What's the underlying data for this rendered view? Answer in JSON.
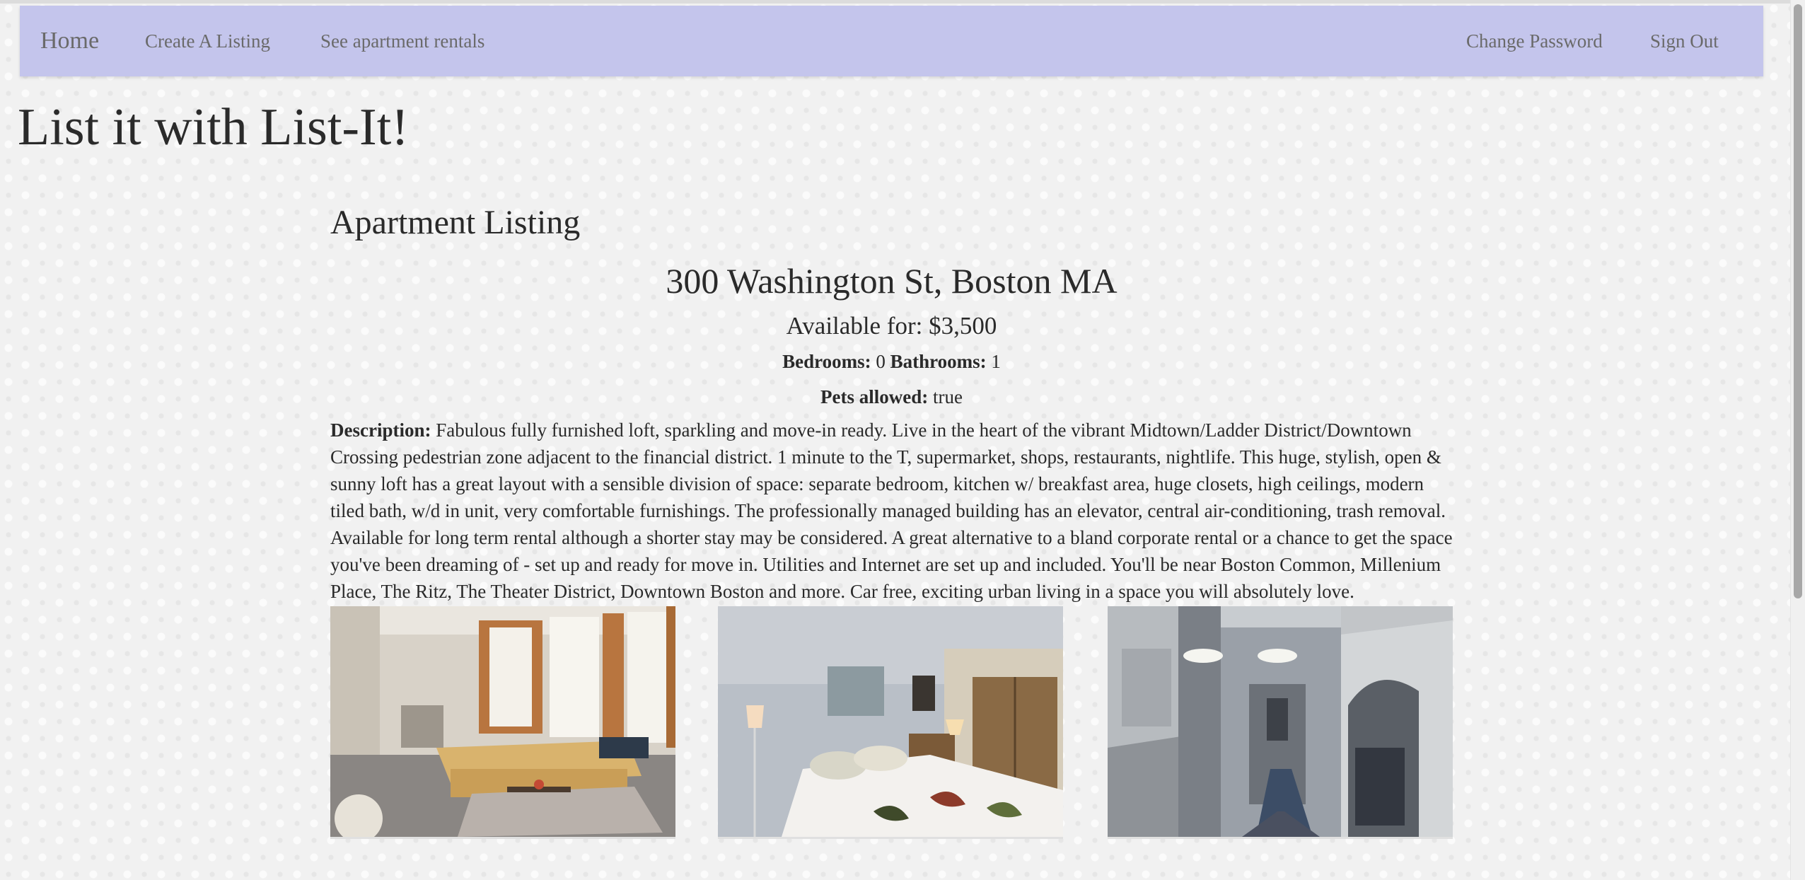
{
  "nav": {
    "home": "Home",
    "create_listing": "Create A Listing",
    "see_rentals": "See apartment rentals",
    "change_password": "Change Password",
    "sign_out": "Sign Out"
  },
  "site_title": "List it with List-It!",
  "section_title": "Apartment Listing",
  "listing": {
    "address": "300 Washington St, Boston MA",
    "price_label": "Available for:",
    "price": "$3,500",
    "bedrooms_label": "Bedrooms:",
    "bedrooms": "0",
    "bathrooms_label": "Bathrooms:",
    "bathrooms": "1",
    "pets_label": "Pets allowed:",
    "pets": "true",
    "description_label": "Description:",
    "description": "Fabulous fully furnished loft, sparkling and move-in ready. Live in the heart of the vibrant Midtown/Ladder District/Downtown Crossing pedestrian zone adjacent to the financial district. 1 minute to the T, supermarket, shops, restaurants, nightlife. This huge, stylish, open & sunny loft has a great layout with a sensible division of space: separate bedroom, kitchen w/ breakfast area, huge closets, high ceilings, modern tiled bath, w/d in unit, very comfortable furnishings. The professionally managed building has an elevator, central air-conditioning, trash removal. Available for long term rental although a shorter stay may be considered. A great alternative to a bland corporate rental or a chance to get the space you've been dreaming of - set up and ready for move in. Utilities and Internet are set up and included. You'll be near Boston Common, Millenium Place, The Ritz, The Theater District, Downtown Boston and more. Car free, exciting urban living in a space you will absolutely love."
  },
  "colors": {
    "navbar": "#c4c5ec",
    "nav_text": "#6a6a6a",
    "body_text": "#2a2a2a",
    "background": "#f1f1f1"
  }
}
